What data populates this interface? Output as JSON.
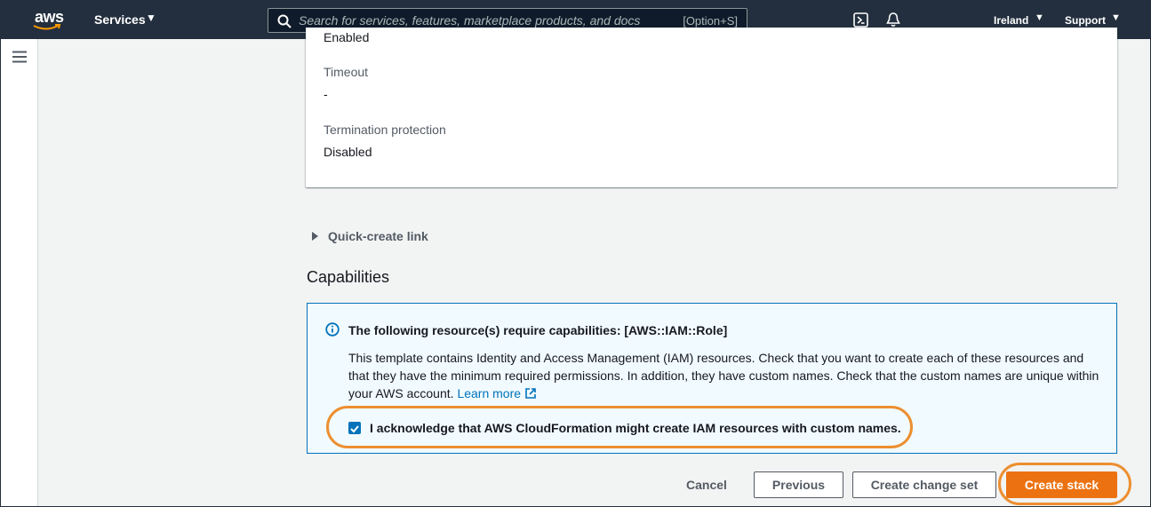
{
  "topnav": {
    "logo_text": "aws",
    "services_label": "Services",
    "search_placeholder": "Search for services, features, marketplace products, and docs",
    "search_shortcut": "[Option+S]",
    "region_label": "Ireland",
    "support_label": "Support"
  },
  "details": {
    "partial_value": "Enabled",
    "timeout_label": "Timeout",
    "timeout_value": "-",
    "termination_label": "Termination protection",
    "termination_value": "Disabled"
  },
  "quick_create_label": "Quick-create link",
  "capabilities": {
    "title": "Capabilities",
    "alert_title": "The following resource(s) require capabilities: [AWS::IAM::Role]",
    "alert_body": "This template contains Identity and Access Management (IAM) resources. Check that you want to create each of these resources and that they have the minimum required permissions. In addition, they have custom names. Check that the custom names are unique within your AWS account.",
    "learn_more": "Learn more",
    "ack_label": "I acknowledge that AWS CloudFormation might create IAM resources with custom names.",
    "ack_checked": true
  },
  "footer": {
    "cancel_label": "Cancel",
    "previous_label": "Previous",
    "change_set_label": "Create change set",
    "create_label": "Create stack"
  },
  "colors": {
    "nav_bg": "#232f3e",
    "primary": "#ec7211",
    "highlight": "#ec8f30",
    "link": "#0073bb",
    "info_bg": "#f1faff"
  }
}
